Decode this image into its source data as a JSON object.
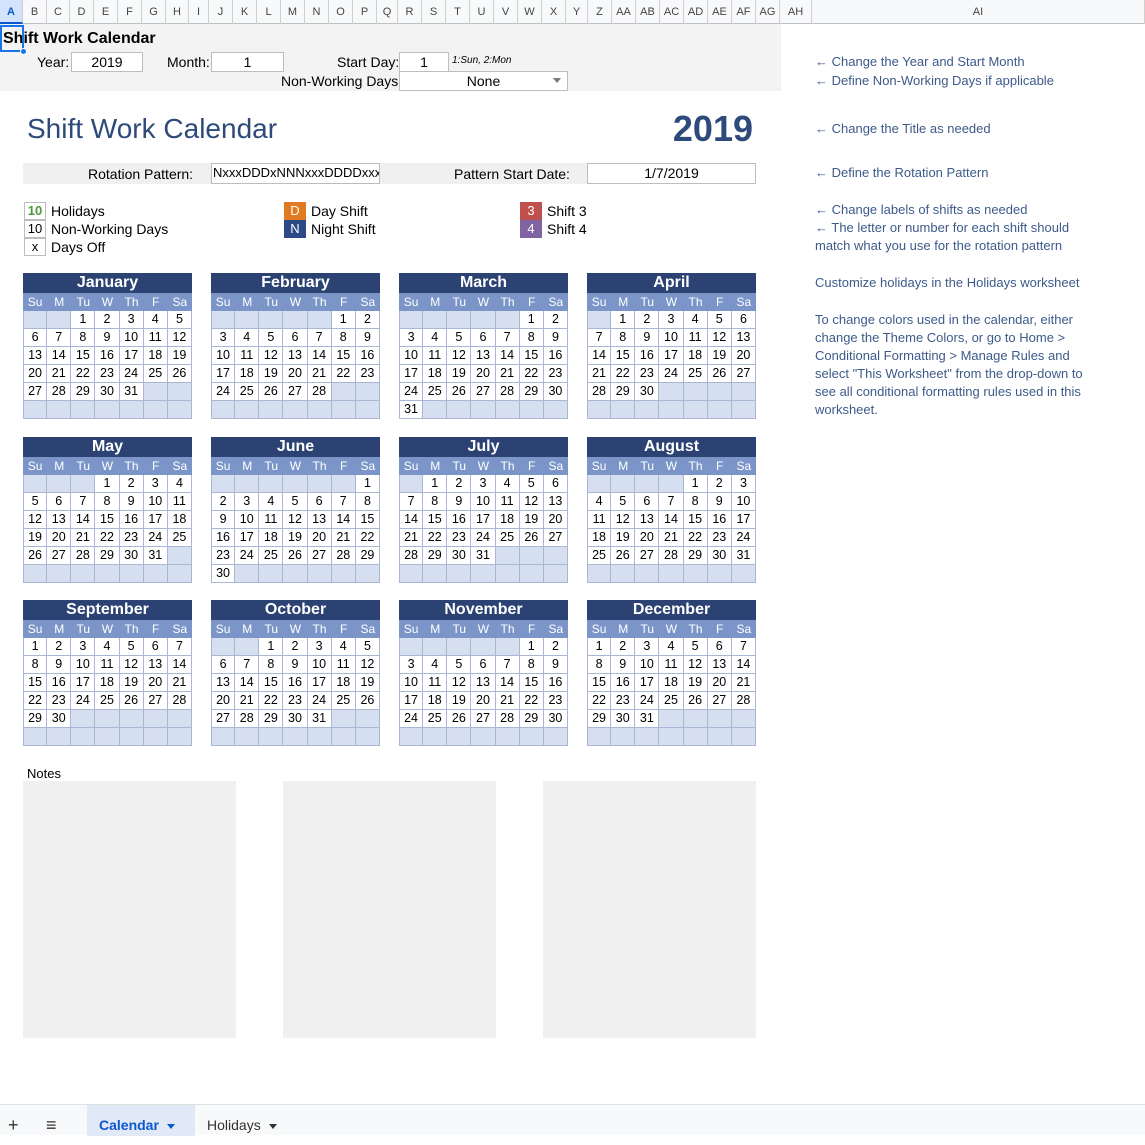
{
  "columns": [
    "A",
    "B",
    "C",
    "D",
    "E",
    "F",
    "G",
    "H",
    "I",
    "J",
    "K",
    "L",
    "M",
    "N",
    "O",
    "P",
    "Q",
    "R",
    "S",
    "T",
    "U",
    "V",
    "W",
    "X",
    "Y",
    "Z",
    "AA",
    "AB",
    "AC",
    "AD",
    "AE",
    "AF",
    "AG",
    "AH",
    "AI"
  ],
  "sheet_title": "Shift Work Calendar",
  "controls": {
    "year_label": "Year:",
    "year_value": "2019",
    "month_label": "Month:",
    "month_value": "1",
    "start_day_label": "Start Day:",
    "start_day_value": "1",
    "start_day_hint": "1:Sun, 2:Mon",
    "nonworking_label": "Non-Working Days:",
    "nonworking_value": "None"
  },
  "calendar_title": "Shift Work Calendar",
  "calendar_year": "2019",
  "rotation_label": "Rotation Pattern:",
  "rotation_value": "NxxxDDDxNNNxxxDDDDxxx",
  "pattern_start_label": "Pattern Start Date:",
  "pattern_start_value": "1/7/2019",
  "legend": {
    "holidays_code": "10",
    "holidays": "Holidays",
    "nonworking_code": "10",
    "nonworking": "Non-Working Days",
    "daysoff_code": "x",
    "daysoff": "Days Off",
    "day_code": "D",
    "day": "Day Shift",
    "night_code": "N",
    "night": "Night Shift",
    "shift3_code": "3",
    "shift3": "Shift 3",
    "shift4_code": "4",
    "shift4": "Shift 4"
  },
  "colors": {
    "header": "#2b4272",
    "dow": "#7b95c8",
    "empty": "#d6dff0",
    "day": "#e07b22",
    "night": "#2e4a86",
    "shift3": "#c0504d",
    "shift4": "#8064a2",
    "holiday": "#4e9a3f"
  },
  "dow_labels": [
    "Su",
    "M",
    "Tu",
    "W",
    "Th",
    "F",
    "Sa"
  ],
  "months": [
    {
      "name": "January",
      "offset": 2,
      "days": 31
    },
    {
      "name": "February",
      "offset": 5,
      "days": 28
    },
    {
      "name": "March",
      "offset": 5,
      "days": 31
    },
    {
      "name": "April",
      "offset": 1,
      "days": 30
    },
    {
      "name": "May",
      "offset": 3,
      "days": 31
    },
    {
      "name": "June",
      "offset": 6,
      "days": 30
    },
    {
      "name": "July",
      "offset": 1,
      "days": 31
    },
    {
      "name": "August",
      "offset": 4,
      "days": 31
    },
    {
      "name": "September",
      "offset": 0,
      "days": 30
    },
    {
      "name": "October",
      "offset": 2,
      "days": 31
    },
    {
      "name": "November",
      "offset": 5,
      "days": 30
    },
    {
      "name": "December",
      "offset": 0,
      "days": 31
    }
  ],
  "notes_label": "Notes",
  "side_notes": [
    "← Change the Year and Start Month",
    "← Define Non-Working Days if applicable",
    "← Change the Title as needed",
    "← Define the Rotation Pattern",
    "← Change labels of shifts as needed",
    "← The letter or number for each shift should",
    "match what you use for the rotation pattern",
    "Customize holidays in the Holidays worksheet",
    "To change colors used in the calendar, either",
    "change the Theme Colors, or go to Home >",
    "Conditional Formatting > Manage Rules and",
    "select \"This Worksheet\" from the drop-down to",
    "see all conditional formatting rules used in this",
    "worksheet."
  ],
  "tabs": {
    "add": "+",
    "menu": "≡",
    "calendar": "Calendar",
    "holidays": "Holidays"
  }
}
